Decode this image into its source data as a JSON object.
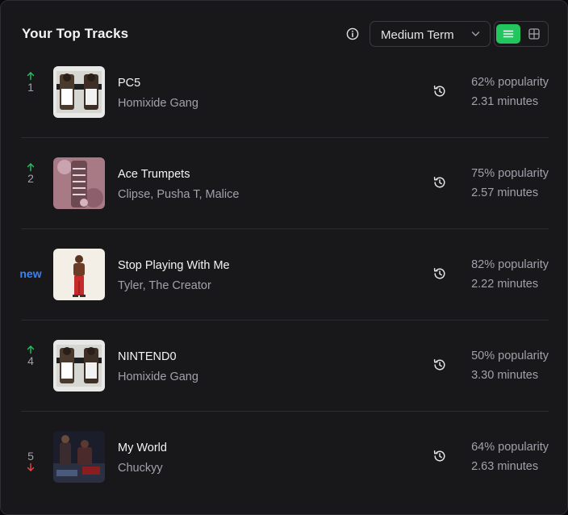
{
  "header": {
    "title": "Your Top Tracks",
    "term_select": {
      "value": "Medium Term"
    },
    "view_toggle": {
      "active": "list"
    }
  },
  "colors": {
    "up": "#22c55e",
    "down": "#ef4444",
    "new": "#3b82f6",
    "toggle_active": "#22c55e"
  },
  "tracks": [
    {
      "rank": "1",
      "change": "up",
      "title": "PC5",
      "artist": "Homixide Gang",
      "popularity": "62% popularity",
      "duration": "2.31 minutes"
    },
    {
      "rank": "2",
      "change": "up",
      "title": "Ace Trumpets",
      "artist": "Clipse, Pusha T, Malice",
      "popularity": "75% popularity",
      "duration": "2.57 minutes"
    },
    {
      "rank": "new",
      "change": "new",
      "title": "Stop Playing With Me",
      "artist": "Tyler, The Creator",
      "popularity": "82% popularity",
      "duration": "2.22 minutes"
    },
    {
      "rank": "4",
      "change": "up",
      "title": "NINTEND0",
      "artist": "Homixide Gang",
      "popularity": "50% popularity",
      "duration": "3.30 minutes"
    },
    {
      "rank": "5",
      "change": "down",
      "title": "My World",
      "artist": "Chuckyy",
      "popularity": "64% popularity",
      "duration": "2.63 minutes"
    }
  ]
}
